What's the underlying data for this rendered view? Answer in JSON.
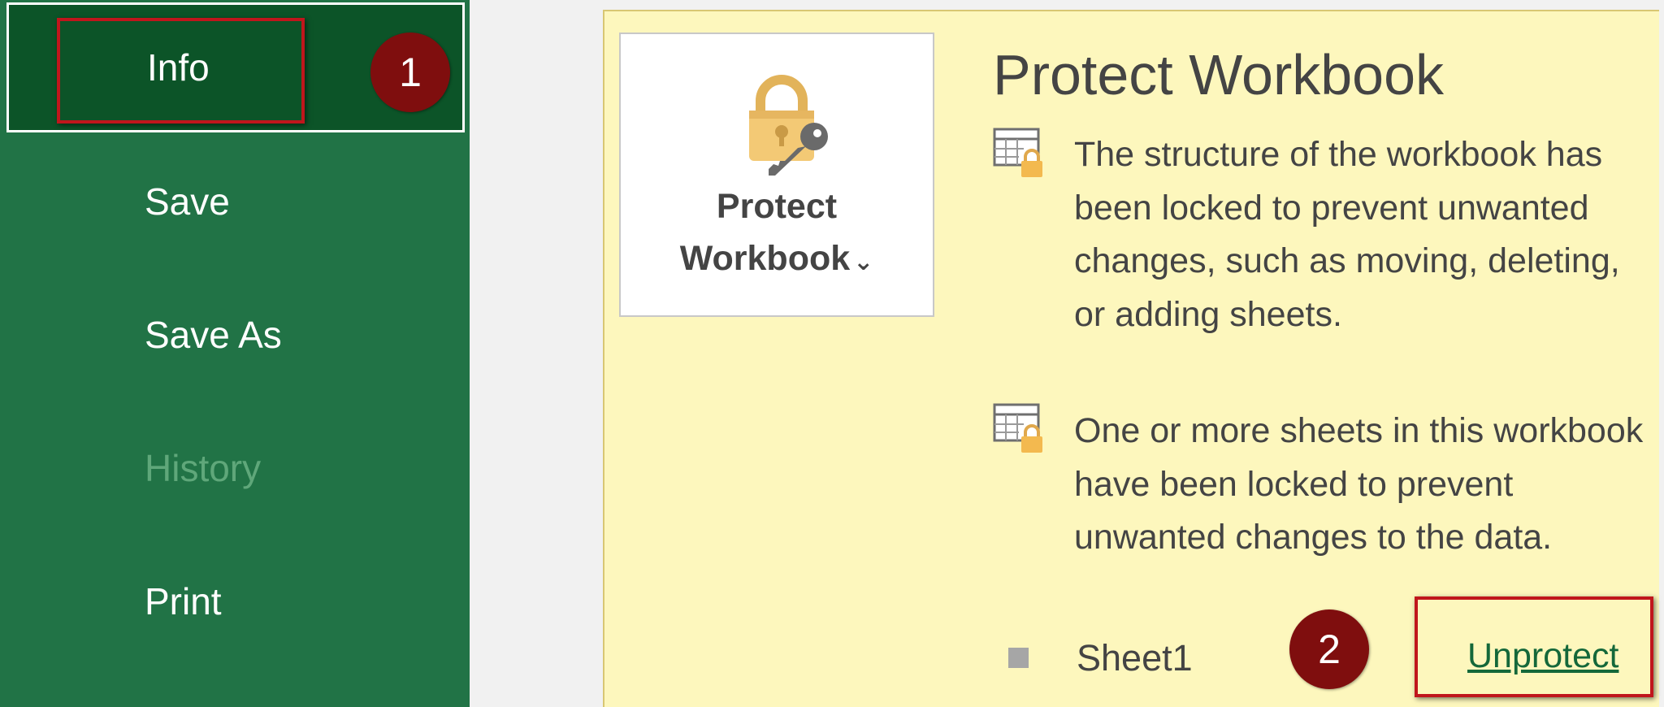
{
  "sidebar": {
    "items": [
      {
        "label": "Info"
      },
      {
        "label": "Save"
      },
      {
        "label": "Save As"
      },
      {
        "label": "History"
      },
      {
        "label": "Print"
      }
    ]
  },
  "badges": {
    "step1": "1",
    "step2": "2"
  },
  "protect": {
    "button_line1": "Protect",
    "button_line2": "Workbook",
    "button_chevron": "⌄",
    "title": "Protect Workbook",
    "structure_text": "The structure of the workbook has been locked to prevent unwanted changes, such as moving, deleting, or adding sheets.",
    "sheets_text": "One or more sheets in this workbook have been locked to prevent unwanted changes to the data.",
    "sheets": [
      {
        "name": "Sheet1",
        "action": "Unprotect"
      }
    ]
  },
  "icons": {
    "button": "lock-key-icon",
    "structure": "workbook-lock-icon",
    "sheets": "sheet-lock-icon"
  },
  "colors": {
    "sidebar_bg": "#217346",
    "sidebar_selected_bg": "#0c5428",
    "panel_bg": "#fdf7bd",
    "highlight": "#c0161c",
    "badge": "#7f0e0e",
    "link": "#14683a"
  }
}
